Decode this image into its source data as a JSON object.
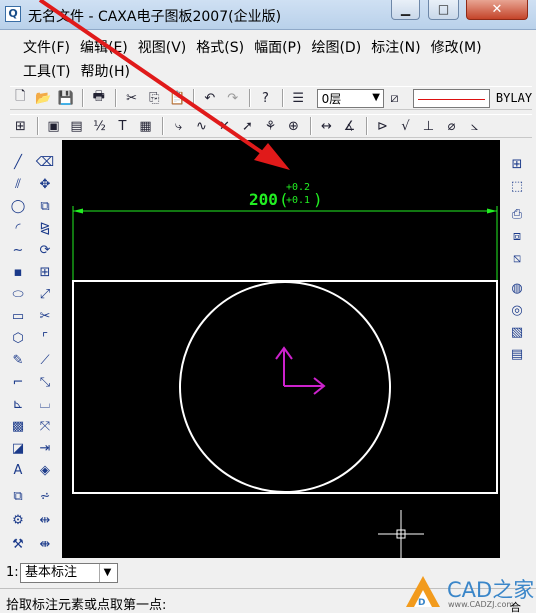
{
  "window": {
    "title": "无名文件 - CAXA电子图板2007(企业版)",
    "app_icon_glyph": "Q",
    "minimize_glyph": "▁",
    "maximize_glyph": "□",
    "close_glyph": "✕"
  },
  "menu": {
    "row1": [
      "文件(F)",
      "编辑(E)",
      "视图(V)",
      "格式(S)",
      "幅面(P)",
      "绘图(D)",
      "标注(N)",
      "修改(M)"
    ],
    "row2": [
      "工具(T)",
      "帮助(H)"
    ]
  },
  "toolbar1": {
    "layer": "0层",
    "linetype_color": "#dd1111",
    "bylayer": "BYLAY"
  },
  "drawing": {
    "dimension_value": "200",
    "tol_upper": "+0.2",
    "tol_lower": "+0.1",
    "colors": {
      "geometry": "#ffffff",
      "dimension": "#22ee22",
      "axes": "#cc22cc",
      "cursor": "#ffffff"
    }
  },
  "bottom": {
    "prefix": "1:",
    "dim_mode": "基本标注",
    "prompt": "拾取标注元素或点取第一点:"
  },
  "watermark": {
    "text": "CAD之家",
    "url": "www.CADZJ.com",
    "page_indicator": "合"
  },
  "annotation": {
    "arrow_color": "#e01a1a"
  }
}
